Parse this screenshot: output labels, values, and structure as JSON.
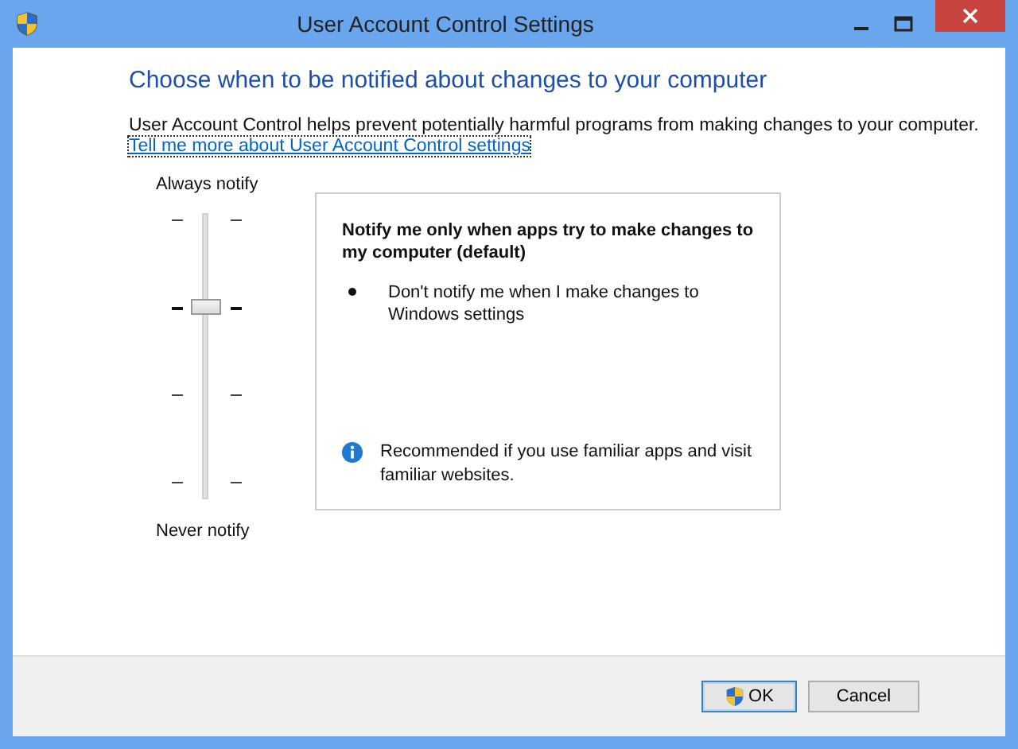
{
  "window": {
    "title": "User Account Control Settings"
  },
  "heading": "Choose when to be notified about changes to your computer",
  "description": "User Account Control helps prevent potentially harmful programs from making changes to your computer.",
  "link": "Tell me more about User Account Control settings",
  "slider": {
    "top_label": "Always notify",
    "bottom_label": "Never notify",
    "level": 0.667
  },
  "panel": {
    "title": "Notify me only when apps try to make changes to my computer (default)",
    "bullets": [
      "Don't notify me when I make changes to Windows settings"
    ],
    "note": "Recommended if you use familiar apps and visit familiar websites."
  },
  "buttons": [
    {
      "label": "OK",
      "kind": "shield"
    },
    {
      "label": "Cancel",
      "kind": "plain"
    }
  ]
}
